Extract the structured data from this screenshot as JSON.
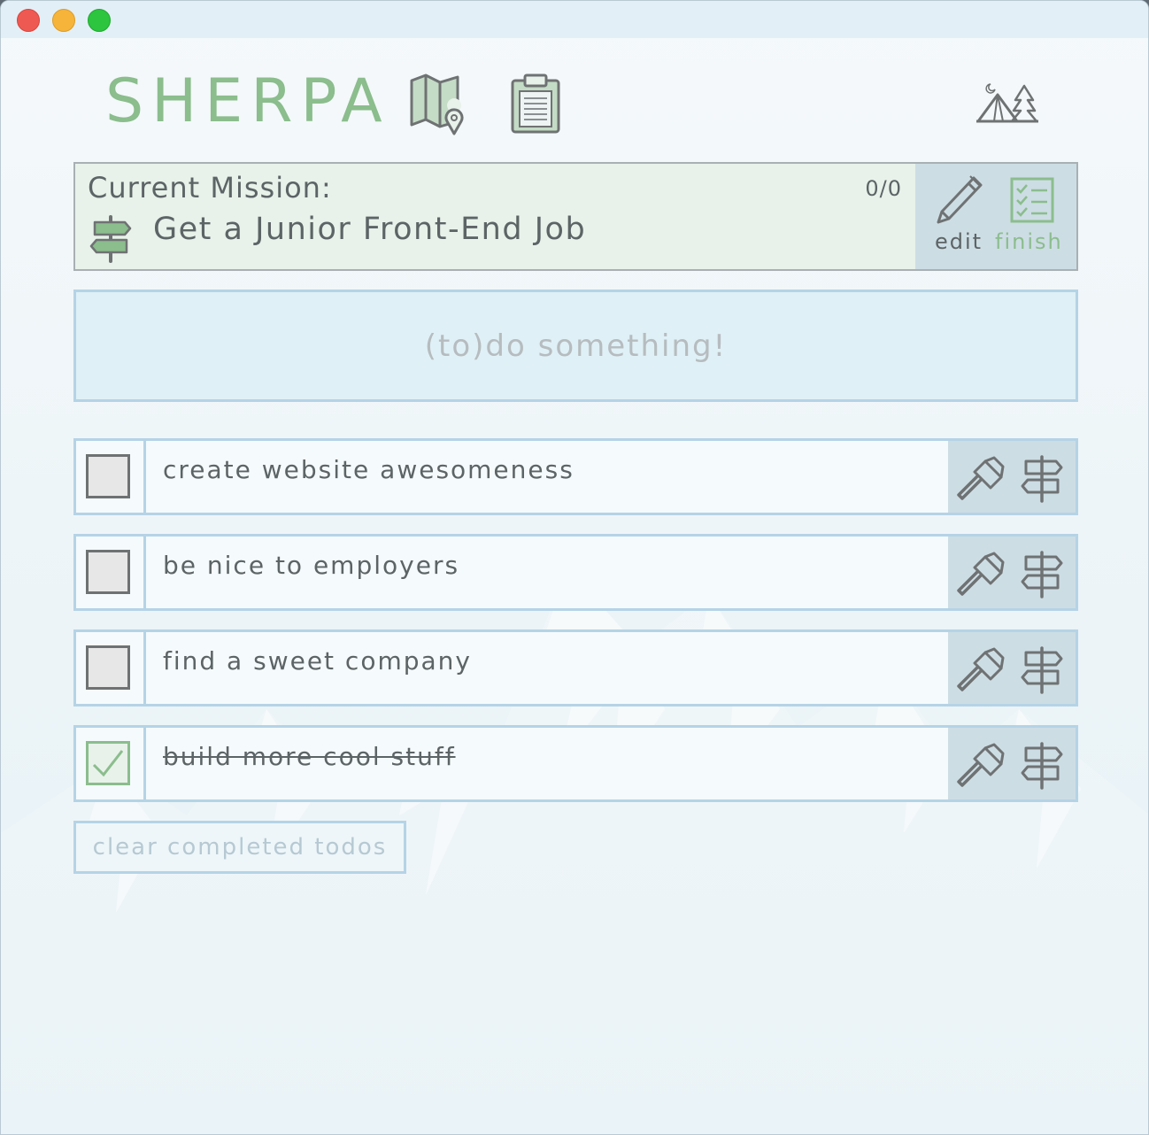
{
  "app": {
    "logo": "SHERPA",
    "icons": {
      "map": "map-icon",
      "clipboard": "clipboard-icon",
      "camp": "campsite-icon"
    }
  },
  "mission": {
    "label": "Current Mission:",
    "count": "0/0",
    "title": "Get a Junior Front-End Job",
    "edit_label": "edit",
    "finish_label": "finish"
  },
  "todo_input": {
    "placeholder": "(to)do something!"
  },
  "todos": [
    {
      "text": "create website awesomeness",
      "completed": false
    },
    {
      "text": "be nice to employers",
      "completed": false
    },
    {
      "text": "find a sweet company",
      "completed": false
    },
    {
      "text": "build more cool stuff",
      "completed": true
    }
  ],
  "clear_button": "clear completed todos",
  "colors": {
    "accent_green": "#8bbd8d",
    "text_gray": "#5d6466",
    "border_blue": "#b5d3e6",
    "action_bg": "#cddde4"
  }
}
